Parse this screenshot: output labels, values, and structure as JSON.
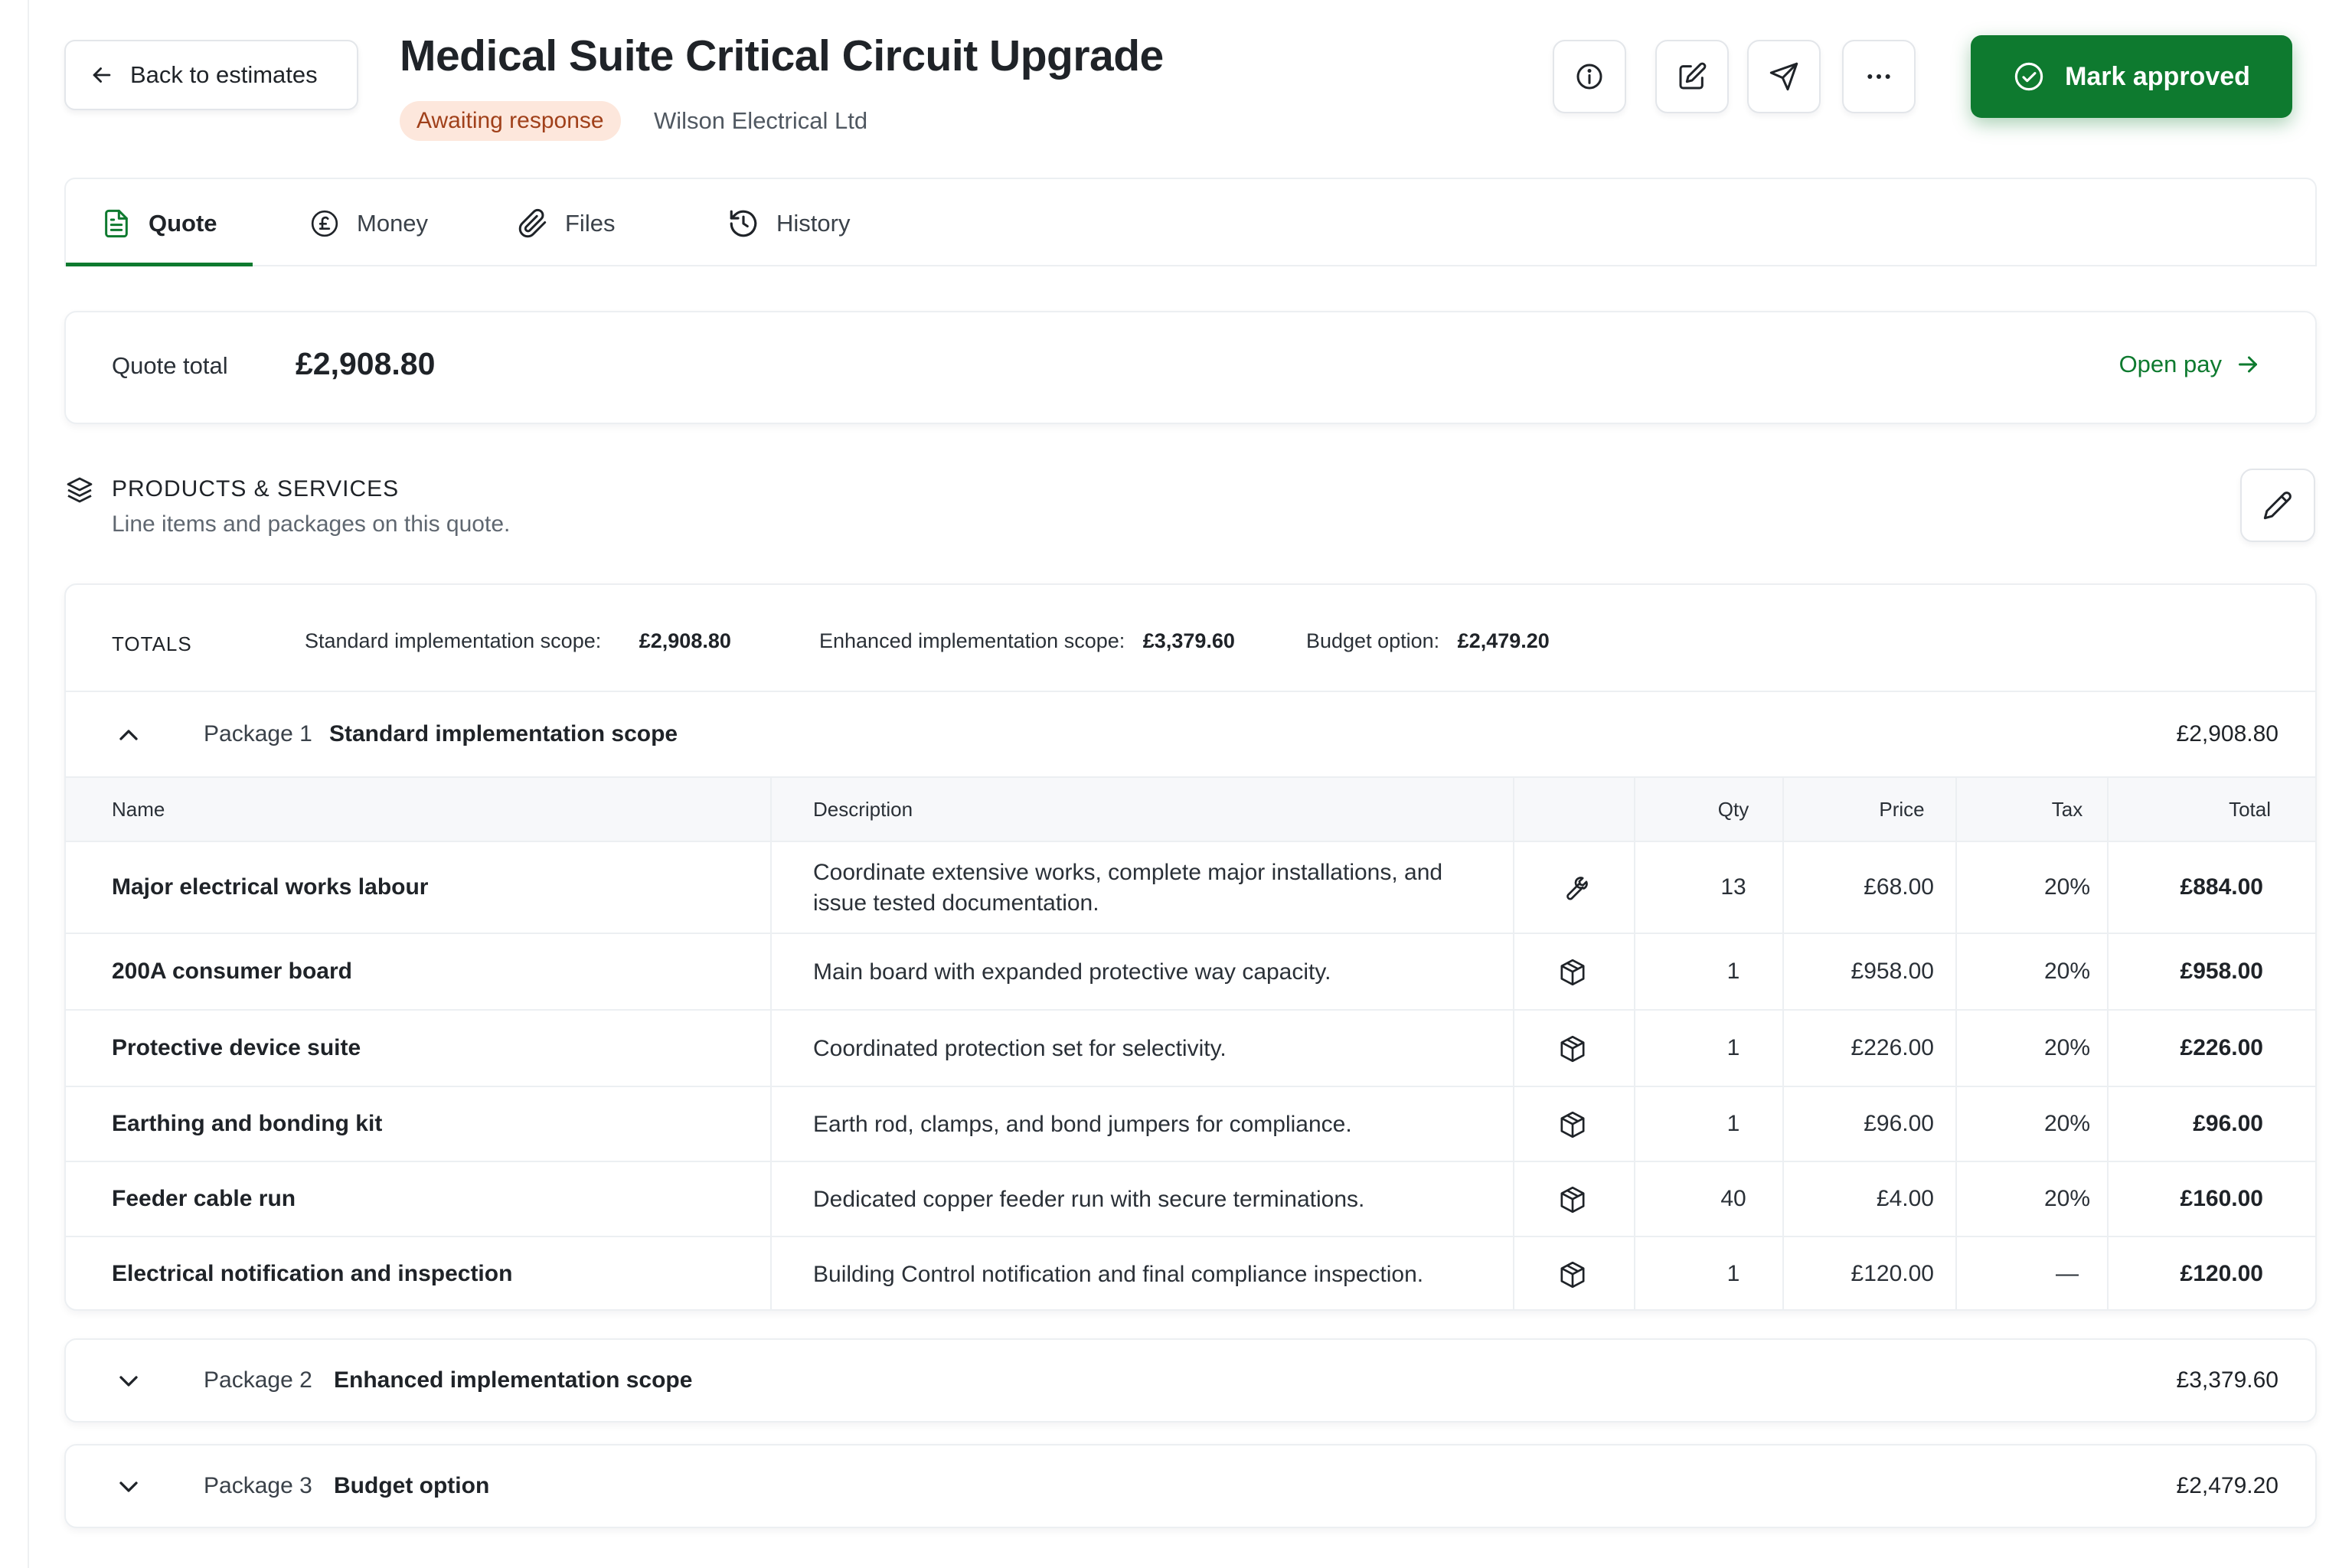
{
  "header": {
    "back_label": "Back to estimates",
    "title": "Medical Suite Critical Circuit Upgrade",
    "status": "Awaiting response",
    "company": "Wilson Electrical Ltd",
    "approve_label": "Mark approved"
  },
  "tabs": [
    {
      "label": "Quote",
      "icon": "document-icon",
      "active": true
    },
    {
      "label": "Money",
      "icon": "pound-icon",
      "active": false
    },
    {
      "label": "Files",
      "icon": "paperclip-icon",
      "active": false
    },
    {
      "label": "History",
      "icon": "history-icon",
      "active": false
    }
  ],
  "quote_total": {
    "label": "Quote total",
    "value": "£2,908.80",
    "open_pay_label": "Open pay"
  },
  "products": {
    "title": "PRODUCTS & SERVICES",
    "subtitle": "Line items and packages on this quote."
  },
  "totals": {
    "label": "TOTALS",
    "items": [
      {
        "name": "Standard implementation scope:",
        "value": "£2,908.80"
      },
      {
        "name": "Enhanced implementation scope:",
        "value": "£3,379.60"
      },
      {
        "name": "Budget option:",
        "value": "£2,479.20"
      }
    ]
  },
  "packages": [
    {
      "number": "Package 1",
      "name": "Standard implementation scope",
      "total": "£2,908.80",
      "expanded": true
    },
    {
      "number": "Package 2",
      "name": "Enhanced implementation scope",
      "total": "£3,379.60",
      "expanded": false
    },
    {
      "number": "Package 3",
      "name": "Budget option",
      "total": "£2,479.20",
      "expanded": false
    }
  ],
  "table": {
    "columns": [
      "Name",
      "Description",
      "",
      "Qty",
      "Price",
      "Tax",
      "Total"
    ],
    "rows": [
      {
        "name": "Major electrical works labour",
        "description": "Coordinate extensive works, complete major installations, and issue tested documentation.",
        "type_icon": "wrench-icon",
        "qty": "13",
        "price": "£68.00",
        "tax": "20%",
        "total": "£884.00"
      },
      {
        "name": "200A consumer board",
        "description": "Main board with expanded protective way capacity.",
        "type_icon": "box-icon",
        "qty": "1",
        "price": "£958.00",
        "tax": "20%",
        "total": "£958.00"
      },
      {
        "name": "Protective device suite",
        "description": "Coordinated protection set for selectivity.",
        "type_icon": "box-icon",
        "qty": "1",
        "price": "£226.00",
        "tax": "20%",
        "total": "£226.00"
      },
      {
        "name": "Earthing and bonding kit",
        "description": "Earth rod, clamps, and bond jumpers for compliance.",
        "type_icon": "box-icon",
        "qty": "1",
        "price": "£96.00",
        "tax": "20%",
        "total": "£96.00"
      },
      {
        "name": "Feeder cable run",
        "description": "Dedicated copper feeder run with secure terminations.",
        "type_icon": "box-icon",
        "qty": "40",
        "price": "£4.00",
        "tax": "20%",
        "total": "£160.00"
      },
      {
        "name": "Electrical notification and inspection",
        "description": "Building Control notification and final compliance inspection.",
        "type_icon": "box-icon",
        "qty": "1",
        "price": "£120.00",
        "tax": "—",
        "total": "£120.00"
      }
    ]
  },
  "colors": {
    "accent": "#0e7a2f",
    "badge_bg": "#fde7dc",
    "badge_text": "#a0401a"
  }
}
